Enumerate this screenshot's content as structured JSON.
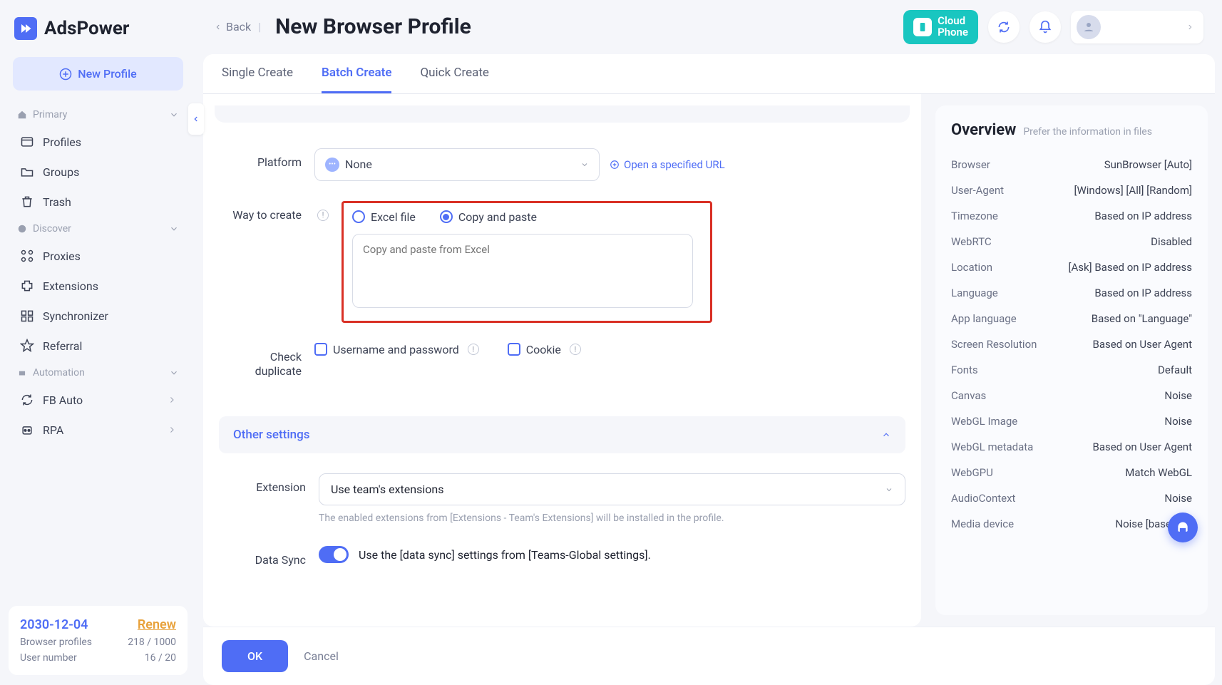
{
  "brand": "AdsPower",
  "sidebar": {
    "new_profile_label": "New Profile",
    "sections": {
      "primary": {
        "label": "Primary",
        "items": [
          "Profiles",
          "Groups",
          "Trash"
        ]
      },
      "discover": {
        "label": "Discover",
        "items": [
          "Proxies",
          "Extensions",
          "Synchronizer",
          "Referral"
        ]
      },
      "automation": {
        "label": "Automation",
        "items": [
          "FB Auto",
          "RPA"
        ]
      }
    }
  },
  "account": {
    "date": "2030-12-04",
    "renew": "Renew",
    "profiles_label": "Browser profiles",
    "profiles_value": "218 / 1000",
    "users_label": "User number",
    "users_value": "16 / 20"
  },
  "header": {
    "back": "Back",
    "title": "New Browser Profile",
    "cloud_phone": "Cloud\nPhone"
  },
  "tabs": [
    "Single Create",
    "Batch Create",
    "Quick Create"
  ],
  "active_tab_index": 1,
  "form": {
    "platform_label": "Platform",
    "platform_value": "None",
    "open_url": "Open a specified URL",
    "way_label": "Way to create",
    "excel_option": "Excel file",
    "copy_option": "Copy and paste",
    "paste_placeholder": "Copy and paste from Excel",
    "check_label": "Check duplicate",
    "check_username": "Username and password",
    "check_cookie": "Cookie",
    "other_settings": "Other settings",
    "extension_label": "Extension",
    "extension_value": "Use team's extensions",
    "extension_hint": "The enabled extensions from [Extensions - Team's Extensions] will be installed in the profile.",
    "datasync_label": "Data Sync",
    "datasync_text": "Use the [data sync] settings from [Teams-Global settings].",
    "ok": "OK",
    "cancel": "Cancel"
  },
  "overview": {
    "title": "Overview",
    "subtitle": "Prefer the information in files",
    "rows": [
      {
        "k": "Browser",
        "v": "SunBrowser [Auto]"
      },
      {
        "k": "User-Agent",
        "v": "[Windows] [All] [Random]"
      },
      {
        "k": "Timezone",
        "v": "Based on IP address"
      },
      {
        "k": "WebRTC",
        "v": "Disabled"
      },
      {
        "k": "Location",
        "v": "[Ask] Based on IP address"
      },
      {
        "k": "Language",
        "v": "Based on IP address"
      },
      {
        "k": "App language",
        "v": "Based on \"Language\""
      },
      {
        "k": "Screen Resolution",
        "v": "Based on User Agent"
      },
      {
        "k": "Fonts",
        "v": "Default"
      },
      {
        "k": "Canvas",
        "v": "Noise"
      },
      {
        "k": "WebGL Image",
        "v": "Noise"
      },
      {
        "k": "WebGL metadata",
        "v": "Based on User Agent"
      },
      {
        "k": "WebGPU",
        "v": "Match WebGL"
      },
      {
        "k": "AudioContext",
        "v": "Noise"
      },
      {
        "k": "Media device",
        "v": "Noise [based on"
      }
    ]
  }
}
